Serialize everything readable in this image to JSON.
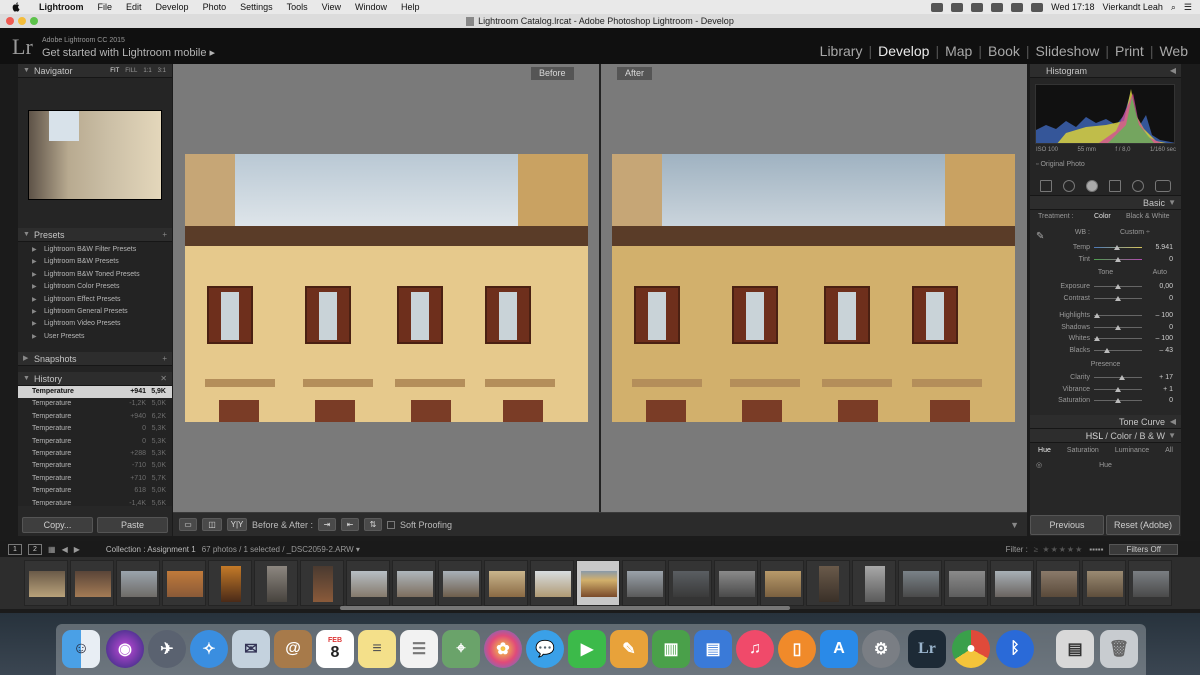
{
  "menubar": {
    "app_name": "Lightroom",
    "items": [
      "File",
      "Edit",
      "Develop",
      "Photo",
      "Settings",
      "Tools",
      "View",
      "Window",
      "Help"
    ],
    "clock": "Wed 17:18",
    "user": "Vierkandt Leah"
  },
  "window": {
    "title": "Lightroom Catalog.lrcat - Adobe Photoshop Lightroom - Develop"
  },
  "identity": {
    "logo": "Lr",
    "subtitle": "Adobe Lightroom CC 2015",
    "main": "Get started with Lightroom mobile",
    "arrow": "▸"
  },
  "modules": [
    {
      "label": "Library"
    },
    {
      "label": "Develop"
    },
    {
      "label": "Map"
    },
    {
      "label": "Book"
    },
    {
      "label": "Slideshow"
    },
    {
      "label": "Print"
    },
    {
      "label": "Web"
    }
  ],
  "left_panel": {
    "navigator": {
      "title": "Navigator",
      "zoom": [
        "FIT",
        "FILL",
        "1:1",
        "3:1"
      ]
    },
    "presets": {
      "title": "Presets",
      "items": [
        "Lightroom B&W Filter Presets",
        "Lightroom B&W Presets",
        "Lightroom B&W Toned Presets",
        "Lightroom Color Presets",
        "Lightroom Effect Presets",
        "Lightroom General Presets",
        "Lightroom Video Presets",
        "User Presets"
      ]
    },
    "snapshots": {
      "title": "Snapshots"
    },
    "history": {
      "title": "History",
      "rows": [
        {
          "name": "Temperature",
          "delta": "+941",
          "value": "5,9K"
        },
        {
          "name": "Temperature",
          "delta": "-1,2K",
          "value": "5,0K"
        },
        {
          "name": "Temperature",
          "delta": "+940",
          "value": "6,2K"
        },
        {
          "name": "Temperature",
          "delta": "0",
          "value": "5,3K"
        },
        {
          "name": "Temperature",
          "delta": "0",
          "value": "5,3K"
        },
        {
          "name": "Temperature",
          "delta": "+288",
          "value": "5,3K"
        },
        {
          "name": "Temperature",
          "delta": "-710",
          "value": "5,0K"
        },
        {
          "name": "Temperature",
          "delta": "+710",
          "value": "5,7K"
        },
        {
          "name": "Temperature",
          "delta": "618",
          "value": "5,0K"
        },
        {
          "name": "Temperature",
          "delta": "-1,4K",
          "value": "5,6K"
        }
      ]
    },
    "copy_label": "Copy...",
    "paste_label": "Paste"
  },
  "center": {
    "before_label": "Before",
    "after_label": "After"
  },
  "toolbar": {
    "yy": "Y|Y",
    "before_after_label": "Before & After :",
    "soft_proofing": "Soft Proofing"
  },
  "right_panel": {
    "histogram": {
      "title": "Histogram",
      "exif": [
        "ISO 100",
        "55 mm",
        "f / 8,0",
        "1/160 sec"
      ],
      "original_photo": "Original Photo"
    },
    "basic": {
      "title": "Basic",
      "treatment_label": "Treatment :",
      "treatment_color": "Color",
      "treatment_bw": "Black & White",
      "wb_label": "WB :",
      "wb_value": "Custom ÷",
      "temp": {
        "label": "Temp",
        "value": "5.941"
      },
      "tint": {
        "label": "Tint",
        "value": "0"
      },
      "tone_label": "Tone",
      "auto_label": "Auto",
      "sliders": [
        {
          "label": "Exposure",
          "value": "0,00"
        },
        {
          "label": "Contrast",
          "value": "0"
        },
        {
          "label": "Highlights",
          "value": "– 100"
        },
        {
          "label": "Shadows",
          "value": "0"
        },
        {
          "label": "Whites",
          "value": "– 100"
        },
        {
          "label": "Blacks",
          "value": "– 43"
        }
      ],
      "presence_label": "Presence",
      "presence": [
        {
          "label": "Clarity",
          "value": "+ 17"
        },
        {
          "label": "Vibrance",
          "value": "+ 1"
        },
        {
          "label": "Saturation",
          "value": "0"
        }
      ]
    },
    "tone_curve": "Tone Curve",
    "hsl": {
      "hsl": "HSL",
      "color": "Color",
      "bw": "B & W",
      "sep": "/"
    },
    "hsl_tabs": [
      "Hue",
      "Saturation",
      "Luminance",
      "All"
    ],
    "hue_label": "Hue",
    "previous_label": "Previous",
    "reset_label": "Reset (Adobe)"
  },
  "filmbar": {
    "screen1": "1",
    "screen2": "2",
    "collection": "Collection : Assignment 1",
    "count": "67 photos / 1 selected / _DSC2059-2.ARW ▾",
    "filter_label": "Filter :",
    "filters_off": "Filters Off"
  },
  "dock": {
    "calendar_month": "FEB",
    "calendar_day": "8",
    "lr_label": "Lr"
  }
}
